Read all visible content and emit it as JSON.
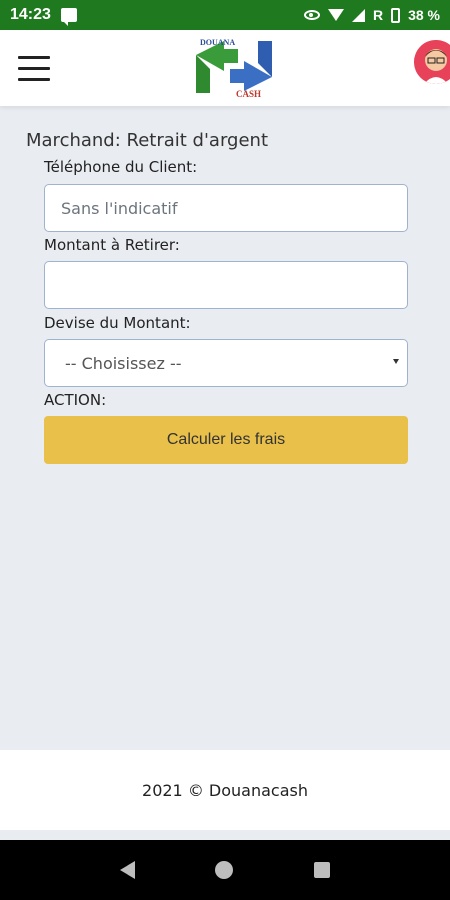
{
  "status_bar": {
    "time": "14:23",
    "battery_text": "38 %",
    "signal_label": "R",
    "icons": [
      "message-icon",
      "eye-icon",
      "wifi-icon",
      "signal-icon",
      "battery-icon"
    ]
  },
  "app_bar": {
    "logo_top_text": "DOUANA",
    "logo_bottom_text": "CASH",
    "menu_icon": "hamburger-menu-icon",
    "avatar_icon": "user-avatar"
  },
  "form": {
    "title": "Marchand: Retrait d'argent",
    "phone_label": "Téléphone du Client:",
    "phone_placeholder": "Sans l'indicatif",
    "phone_value": "",
    "amount_label": "Montant à Retirer:",
    "amount_value": "",
    "currency_label": "Devise du Montant:",
    "currency_selected": "-- Choisissez --",
    "action_label": "ACTION:",
    "submit_label": "Calculer les frais"
  },
  "footer": {
    "text": "2021 © Douanacash"
  },
  "colors": {
    "status_bar": "#1f7a1f",
    "button": "#e9c04a",
    "background": "#e9ecf1",
    "input_border": "#9fb3d0"
  }
}
